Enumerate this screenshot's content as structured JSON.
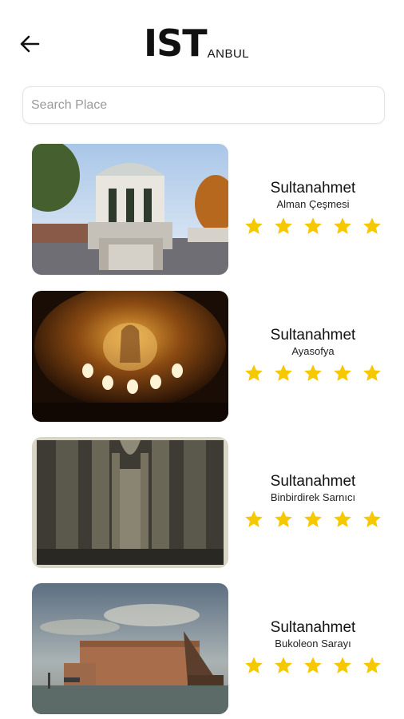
{
  "header": {
    "logo_big": "IST",
    "logo_small": "ANBUL",
    "back_icon": "arrow-left-icon"
  },
  "search": {
    "placeholder": "Search Place",
    "value": ""
  },
  "colors": {
    "star": "#f5c800",
    "text": "#111111",
    "border": "#e3e3e3"
  },
  "places": [
    {
      "title": "Sultanahmet",
      "subtitle": "Alman Çeşmesi",
      "rating": 5,
      "rating_max": 5
    },
    {
      "title": "Sultanahmet",
      "subtitle": "Ayasofya",
      "rating": 5,
      "rating_max": 5
    },
    {
      "title": "Sultanahmet",
      "subtitle": "Binbirdirek Sarnıcı",
      "rating": 5,
      "rating_max": 5
    },
    {
      "title": "Sultanahmet",
      "subtitle": "Bukoleon Sarayı",
      "rating": 5,
      "rating_max": 5
    }
  ]
}
